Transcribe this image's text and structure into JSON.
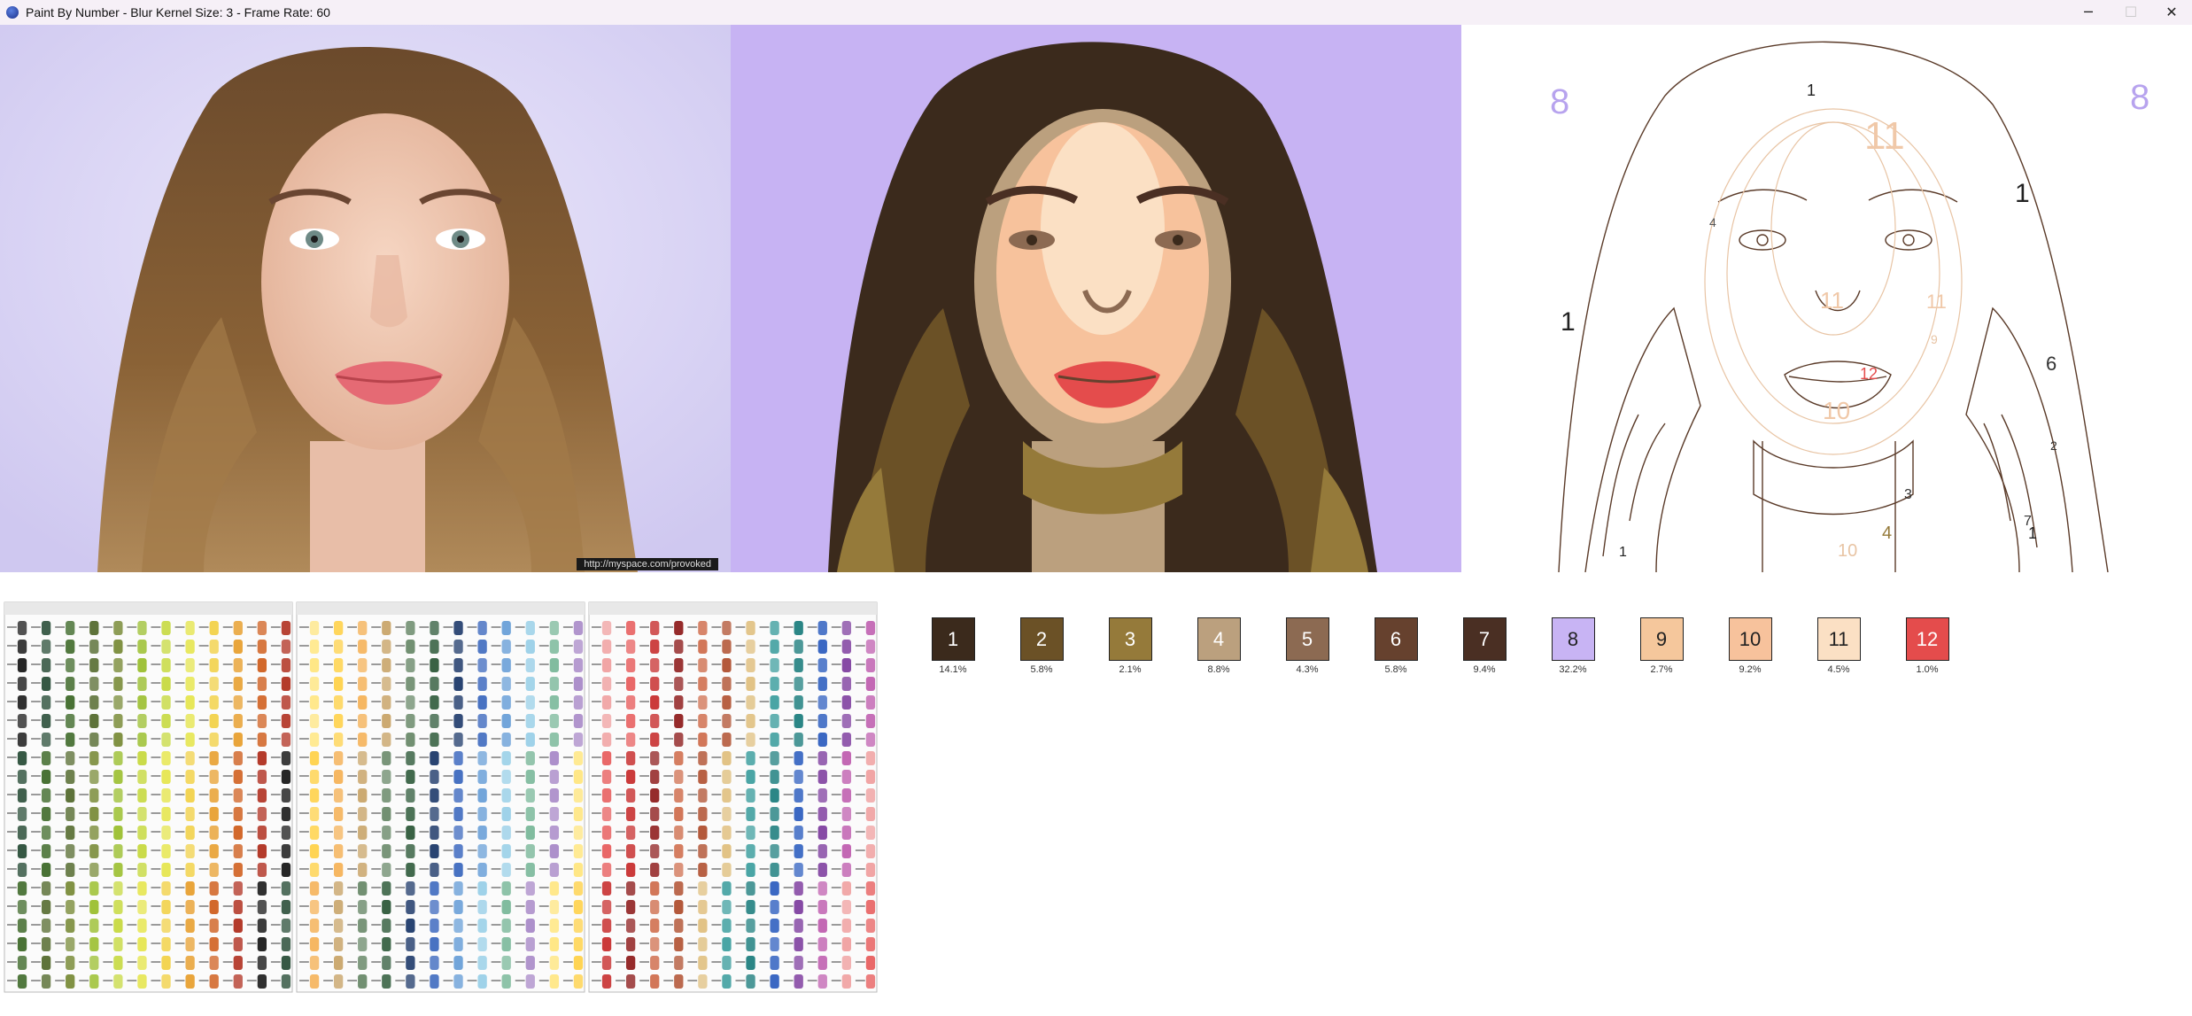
{
  "window": {
    "title": "Paint By Number - Blur Kernel Size: 3 - Frame Rate: 60",
    "minimize_glyph": "─",
    "maximize_glyph": "☐",
    "close_glyph": "✕"
  },
  "original_photo": {
    "watermark": "http://myspace.com/provoked"
  },
  "outline_labels": [
    "8",
    "8",
    "1",
    "1",
    "1",
    "11",
    "11",
    "11",
    "10",
    "12",
    "6",
    "4",
    "7",
    "3",
    "2",
    "10",
    "4",
    "1",
    "1",
    "9"
  ],
  "palette": [
    {
      "number": "1",
      "percent": "14.1%",
      "color": "#3b2a1c",
      "text_color": "#ffffff"
    },
    {
      "number": "2",
      "percent": "5.8%",
      "color": "#6b5126",
      "text_color": "#ffffff"
    },
    {
      "number": "3",
      "percent": "2.1%",
      "color": "#957a3a",
      "text_color": "#ffffff"
    },
    {
      "number": "4",
      "percent": "8.8%",
      "color": "#bba07e",
      "text_color": "#ffffff"
    },
    {
      "number": "5",
      "percent": "4.3%",
      "color": "#8c6a52",
      "text_color": "#ffffff"
    },
    {
      "number": "6",
      "percent": "5.8%",
      "color": "#66412e",
      "text_color": "#ffffff"
    },
    {
      "number": "7",
      "percent": "9.4%",
      "color": "#4a2f23",
      "text_color": "#ffffff"
    },
    {
      "number": "8",
      "percent": "32.2%",
      "color": "#c8b4f4",
      "text_color": "#222222"
    },
    {
      "number": "9",
      "percent": "2.7%",
      "color": "#f5c79c",
      "text_color": "#222222"
    },
    {
      "number": "10",
      "percent": "9.2%",
      "color": "#f7c29c",
      "text_color": "#222222"
    },
    {
      "number": "11",
      "percent": "4.5%",
      "color": "#fbe0c4",
      "text_color": "#222222"
    },
    {
      "number": "12",
      "percent": "1.0%",
      "color": "#e44c4c",
      "text_color": "#ffffff"
    }
  ],
  "colors": {
    "background_lavender": "#c7b3f3",
    "photo_background": "#d8d3f3",
    "outline_stroke": "#5a3a28"
  }
}
